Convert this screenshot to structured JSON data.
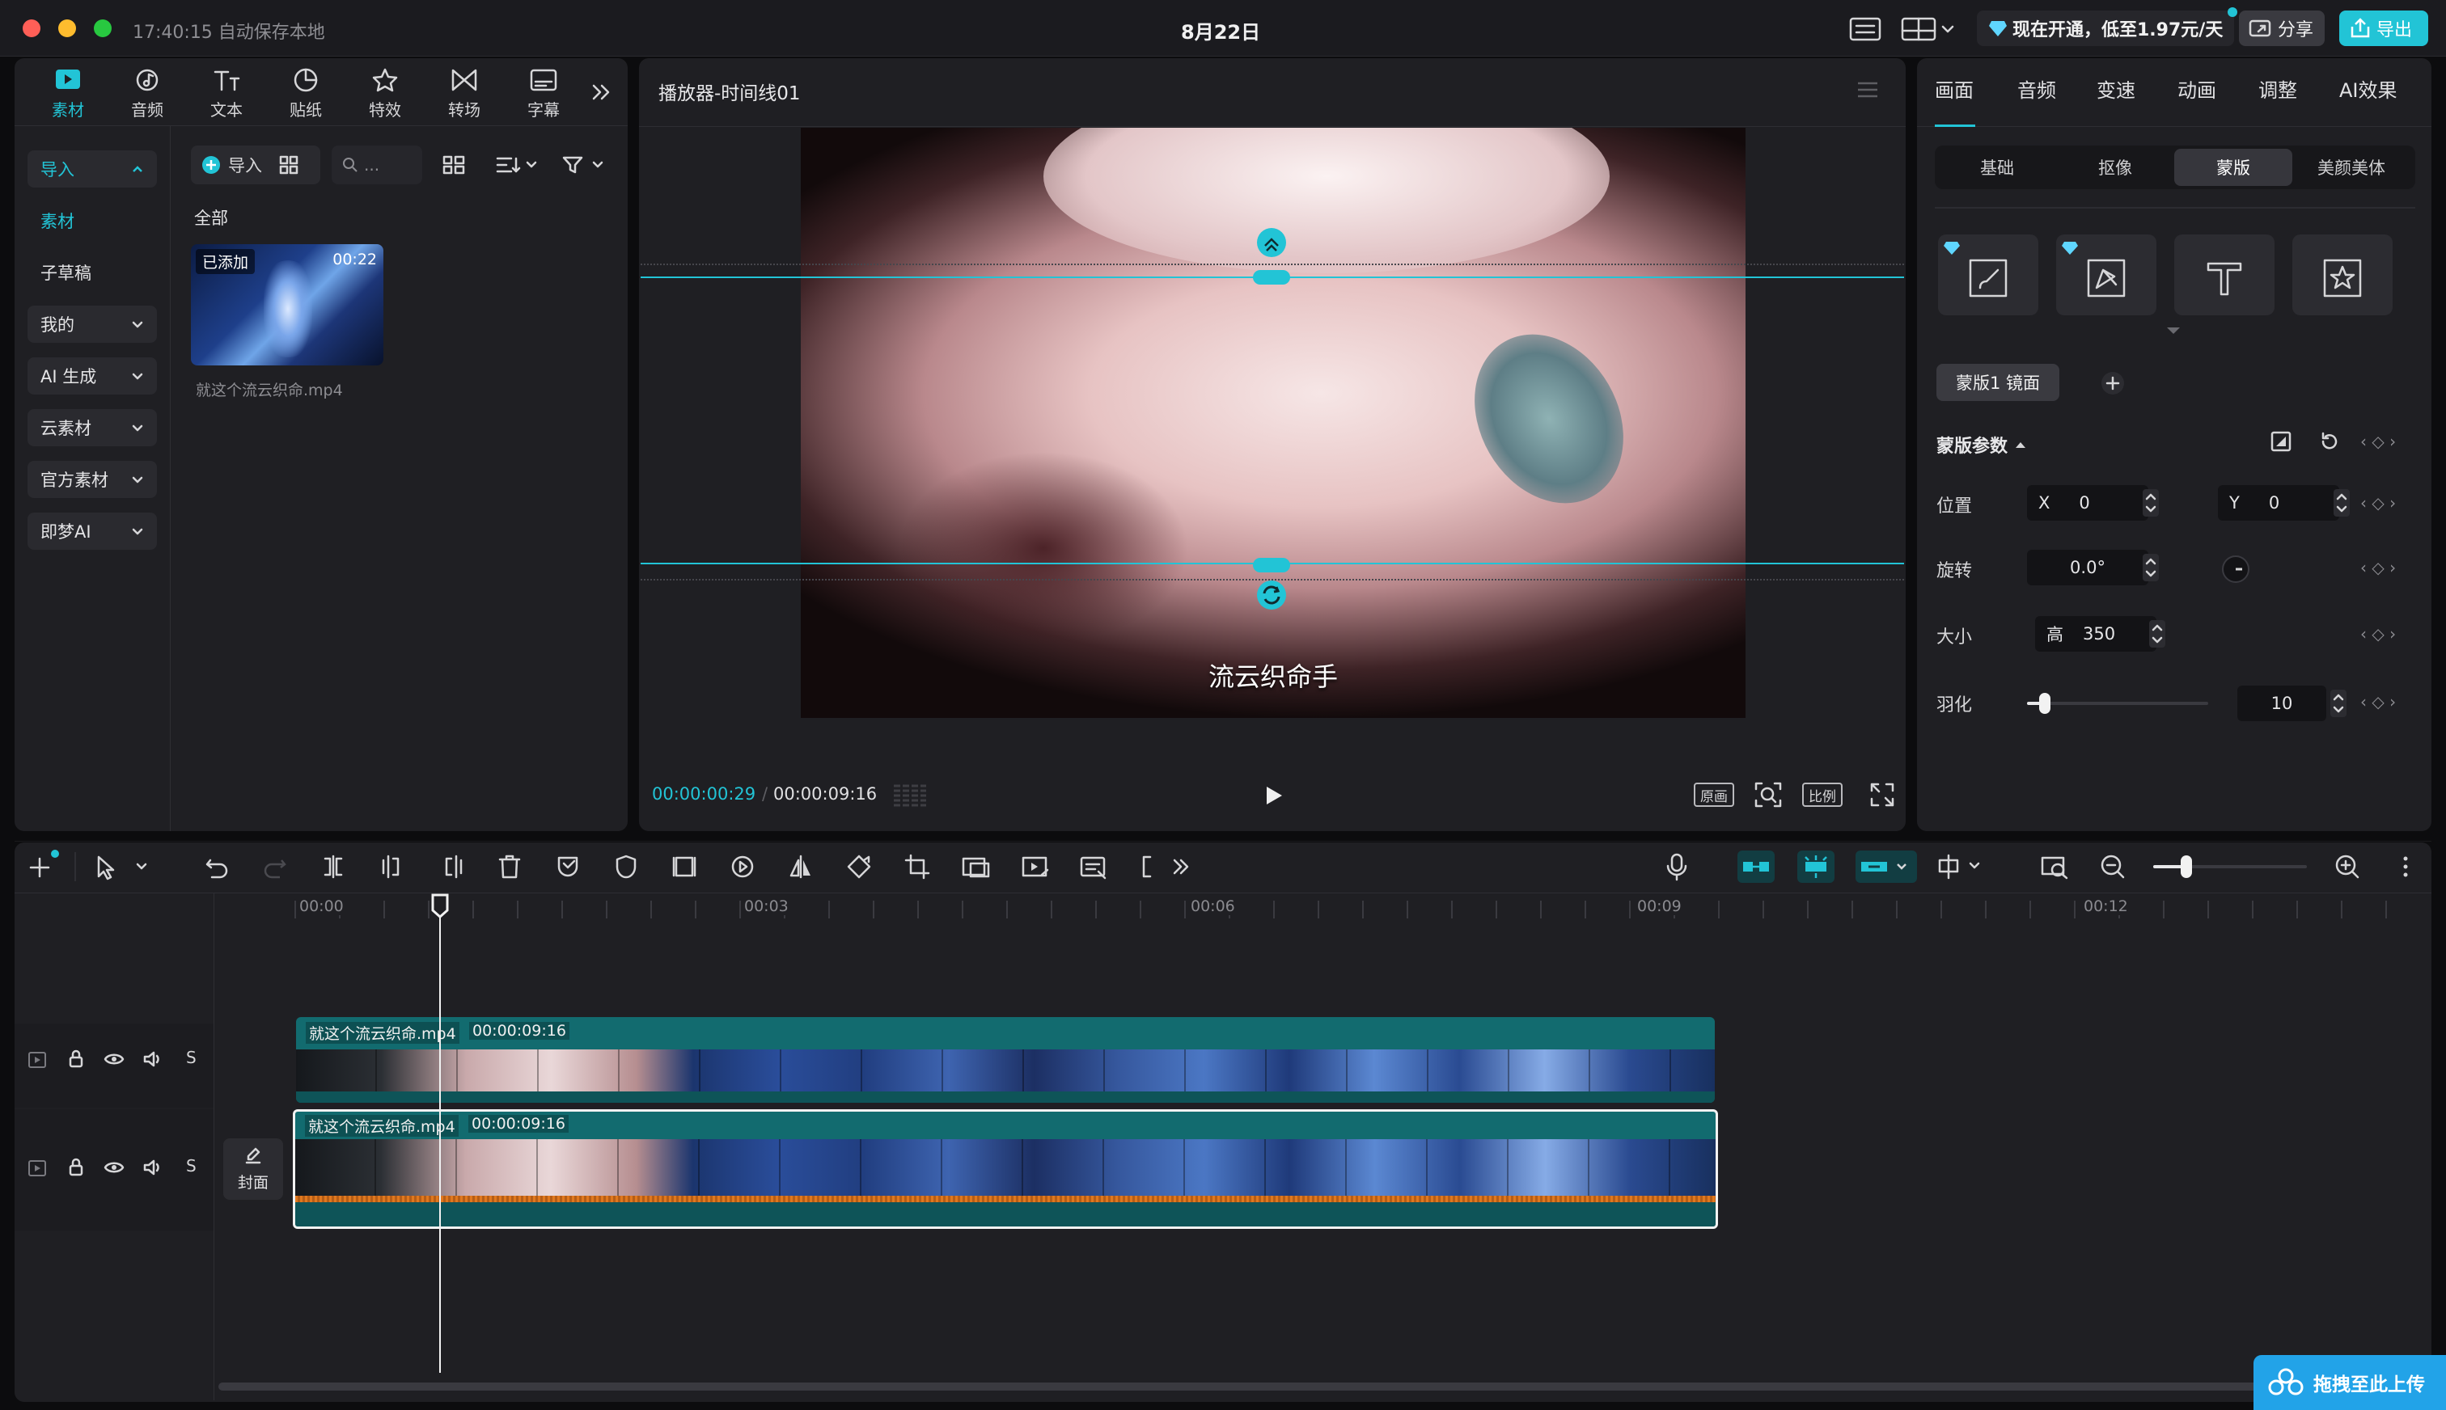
{
  "titlebar": {
    "autosave": "17:40:15 自动保存本地",
    "project_title": "8月22日",
    "promo": "现在开通，低至1.97元/天",
    "share_label": "分享",
    "export_label": "导出"
  },
  "media_tabs": [
    {
      "label": "素材",
      "icon": "media-icon",
      "active": true
    },
    {
      "label": "音频",
      "icon": "audio-icon"
    },
    {
      "label": "文本",
      "icon": "text-icon"
    },
    {
      "label": "贴纸",
      "icon": "sticker-icon"
    },
    {
      "label": "特效",
      "icon": "effects-icon"
    },
    {
      "label": "转场",
      "icon": "transition-icon"
    },
    {
      "label": "字幕",
      "icon": "caption-icon"
    }
  ],
  "left_nav": {
    "import_label": "导入",
    "items": [
      "素材",
      "子草稿",
      "我的",
      "AI 生成",
      "云素材",
      "官方素材",
      "即梦AI"
    ]
  },
  "media_panel": {
    "import_button": "导入",
    "search_placeholder": "...",
    "filter_all": "全部",
    "clip": {
      "badge": "已添加",
      "duration": "00:22",
      "filename": "就这个流云织命.mp4"
    }
  },
  "player": {
    "title": "播放器-时间线01",
    "subtitle": "流云织命手",
    "current_time": "00:00:00:29",
    "total_time": "00:00:09:16",
    "btn_original": "原画",
    "btn_ratio": "比例"
  },
  "inspector": {
    "tabs": [
      "画面",
      "音频",
      "变速",
      "动画",
      "调整",
      "AI效果"
    ],
    "active_tab": "画面",
    "segments": [
      "基础",
      "抠像",
      "蒙版",
      "美颜美体"
    ],
    "active_segment": "蒙版",
    "mask_chip": "蒙版1 镜面",
    "params_title": "蒙版参数",
    "position_label": "位置",
    "pos_x_label": "X",
    "pos_x_value": "0",
    "pos_y_label": "Y",
    "pos_y_value": "0",
    "rotation_label": "旋转",
    "rotation_value": "0.0°",
    "size_label": "大小",
    "size_height_label": "高",
    "size_value": "350",
    "feather_label": "羽化",
    "feather_value": "10",
    "feather_level": 0.1
  },
  "timeline": {
    "ruler": [
      "00:00",
      "00:03",
      "00:06",
      "00:09",
      "00:12"
    ],
    "track1": {
      "name": "就这个流云织命.mp4",
      "duration": "00:00:09:16"
    },
    "track2": {
      "name": "就这个流云织命.mp4",
      "duration": "00:00:09:16"
    },
    "cover_label": "封面",
    "solo_label": "S",
    "upload_label": "拖拽至此上传"
  },
  "colors": {
    "accent": "#22c4d6",
    "track": "#126b6f",
    "bg": "#1f1f23"
  }
}
